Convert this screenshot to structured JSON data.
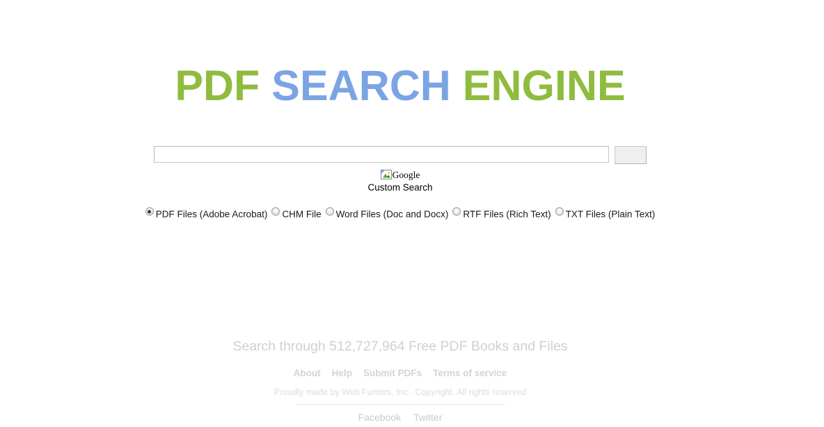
{
  "page": {
    "background_color": "#ffffff"
  },
  "title": {
    "part1": "PDF ",
    "part2": "SEARCH",
    "part3": " ENGINE",
    "color_green": "#8fbc3f",
    "color_blue": "#7ba4e4"
  },
  "search": {
    "input_value": "",
    "input_placeholder": "",
    "button_label": ""
  },
  "branding": {
    "image_alt": "Google",
    "image_icon": "broken-image-icon",
    "line2": "Custom Search"
  },
  "file_types": {
    "options": [
      {
        "label": "PDF Files (Adobe Acrobat)",
        "checked": true
      },
      {
        "label": "CHM File",
        "checked": false
      },
      {
        "label": "Word Files (Doc and Docx)",
        "checked": false
      },
      {
        "label": "RTF Files (Rich Text)",
        "checked": false
      },
      {
        "label": "TXT Files (Plain Text)",
        "checked": false
      }
    ]
  },
  "footer": {
    "tagline": "Search through 512,727,964 Free PDF Books and Files",
    "book_count": "512,727,964",
    "links": [
      {
        "label": "About"
      },
      {
        "label": "Help"
      },
      {
        "label": "Submit PDFs"
      },
      {
        "label": "Terms of service"
      }
    ],
    "copyright": "Proudly made by Web Funters, Inc . Copyright. All rights reserved",
    "social": [
      {
        "label": "Facebook"
      },
      {
        "label": "Twitter"
      }
    ]
  }
}
